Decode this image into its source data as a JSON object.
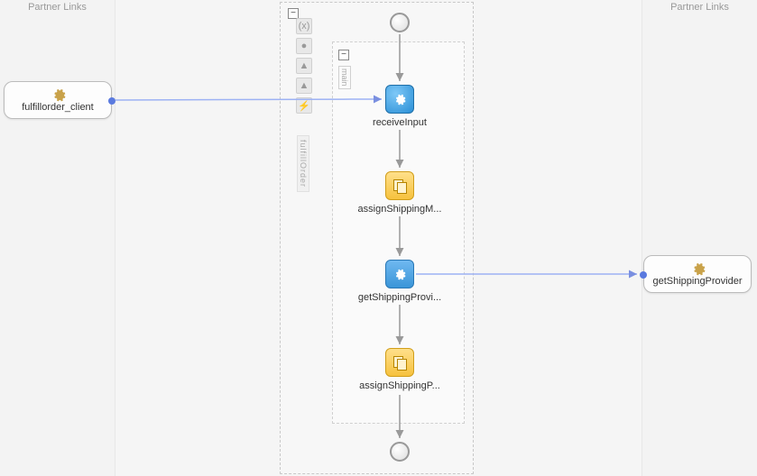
{
  "left_panel": {
    "title": "Partner Links"
  },
  "right_panel": {
    "title": "Partner Links"
  },
  "partner_links": {
    "left": {
      "name": "fulfillorder_client"
    },
    "right": {
      "name": "getShippingProvider"
    }
  },
  "process": {
    "name_label": "fulfillOrder",
    "main_scope_label": "main",
    "collapse_glyph": "−",
    "activities": {
      "receive": {
        "label": "receiveInput"
      },
      "assign1": {
        "label": "assignShippingM..."
      },
      "invoke": {
        "label": "getShippingProvi..."
      },
      "assign2": {
        "label": "assignShippingP..."
      }
    }
  },
  "palette": {
    "tools": [
      "(x)",
      "●",
      "▲",
      "▲",
      "⚡"
    ]
  }
}
